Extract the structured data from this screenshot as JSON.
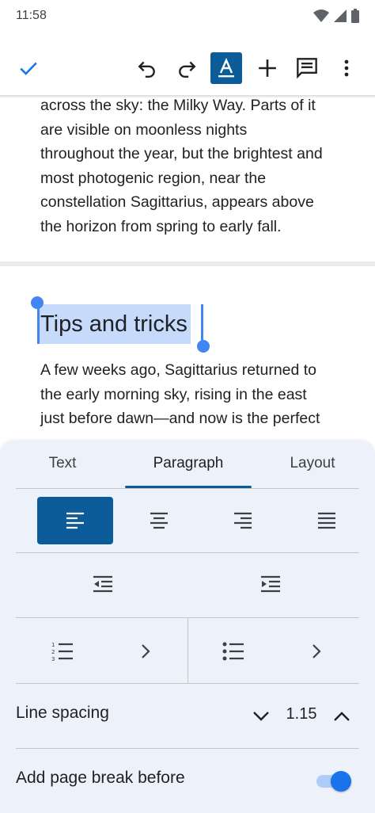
{
  "status_bar": {
    "time": "11:58"
  },
  "document": {
    "para1_lines": [
      "across the sky: the Milky Way. Parts of it",
      "are visible on moonless nights",
      "throughout the year, but the brightest and",
      "most photogenic region, near the",
      "constellation Sagittarius, appears above",
      "the horizon from spring to early fall."
    ],
    "heading": "Tips and tricks",
    "para2_lines": [
      "A few weeks ago, Sagittarius returned to",
      "the early morning sky, rising in the east",
      "just before dawn—and now is the perfect"
    ]
  },
  "format_panel": {
    "tabs": [
      "Text",
      "Paragraph",
      "Layout"
    ],
    "selected_tab": "Paragraph",
    "alignment_selected": "left",
    "line_spacing_label": "Line spacing",
    "line_spacing_value": "1.15",
    "page_break_label": "Add page break before",
    "page_break_enabled": true
  },
  "colors": {
    "accent": "#0b5c99",
    "selection": "#c6dafb",
    "handle": "#4285f4",
    "sheet_bg": "#edf2fa",
    "toggle_on": "#1a73e8"
  },
  "icons": {
    "check": "check-icon",
    "undo": "undo-icon",
    "redo": "redo-icon",
    "format": "text-format-icon",
    "add": "plus-icon",
    "comment": "comment-icon",
    "more": "more-vert-icon"
  }
}
